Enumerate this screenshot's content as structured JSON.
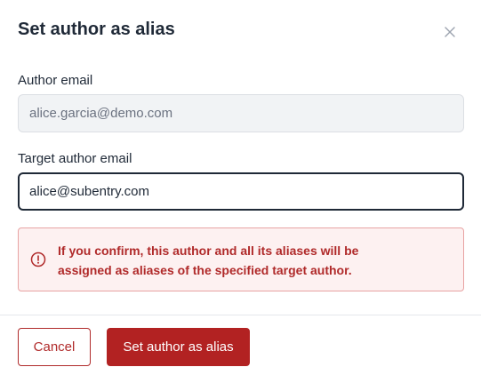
{
  "dialog": {
    "title": "Set author as alias",
    "close_icon": "close-icon"
  },
  "fields": {
    "author_email_label": "Author email",
    "author_email_value": "alice.garcia@demo.com",
    "target_email_label": "Target author email",
    "target_email_value": "alice@subentry.com"
  },
  "alert": {
    "icon": "alert-circle-icon",
    "line1": "If you confirm, this author and all its aliases will be",
    "line2": "assigned as aliases of the specified target author."
  },
  "actions": {
    "cancel_label": "Cancel",
    "confirm_label": "Set author as alias"
  },
  "colors": {
    "danger": "#b22222",
    "alert_background": "#fdf1f1",
    "alert_border": "#e8a3a3",
    "title_text": "#1f2937"
  }
}
